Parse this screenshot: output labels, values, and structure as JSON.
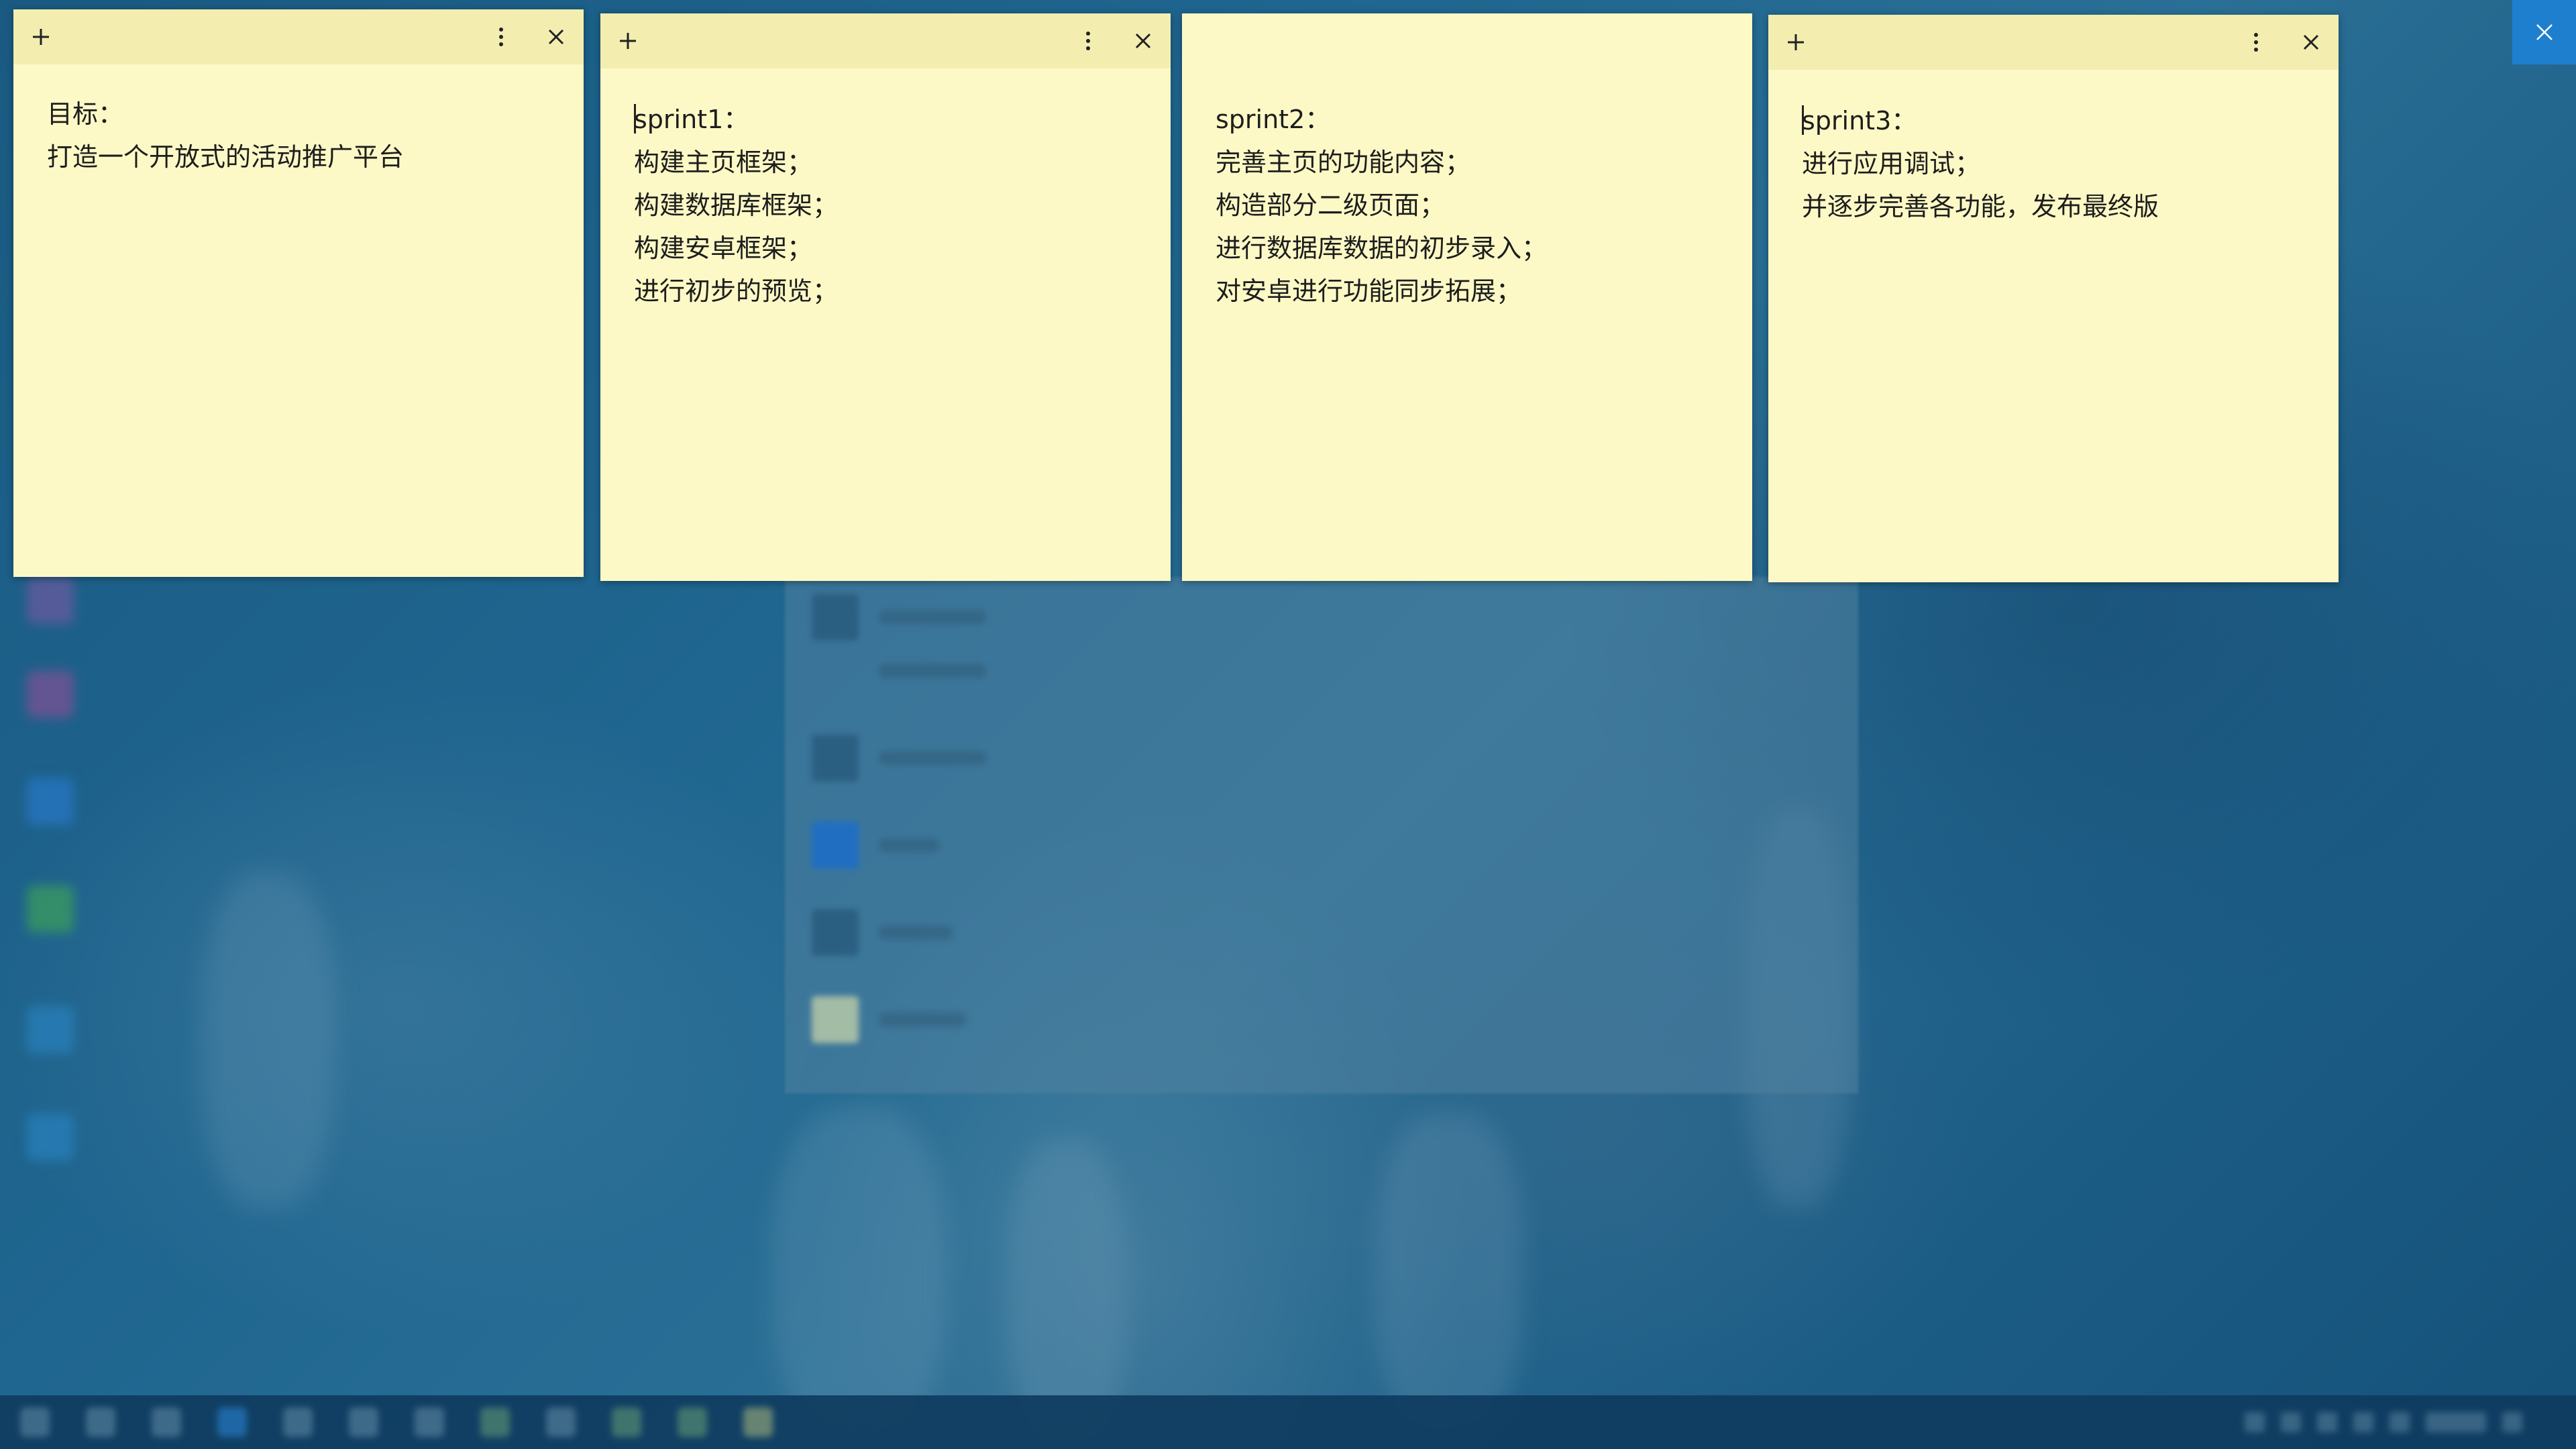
{
  "screen": {
    "colors": {
      "note_body": "#fdf9c6",
      "note_header": "#f3eeb0",
      "corner_close": "#1f7fcf",
      "desktop": "#1f6690"
    }
  },
  "corner_close": {
    "icon": "close-icon"
  },
  "notes": [
    {
      "has_header": true,
      "header_icons": [
        "add-icon",
        "more-vertical-icon",
        "close-icon"
      ],
      "lines": [
        "目标：",
        "打造一个开放式的活动推广平台"
      ],
      "has_caret": false
    },
    {
      "has_header": true,
      "header_icons": [
        "add-icon",
        "more-vertical-icon",
        "close-icon"
      ],
      "lines": [
        "sprint1：",
        "构建主页框架；",
        "构建数据库框架；",
        "构建安卓框架；",
        "进行初步的预览；"
      ],
      "has_caret": true
    },
    {
      "has_header": false,
      "lines": [
        "sprint2：",
        "完善主页的功能内容；",
        "构造部分二级页面；",
        "进行数据库数据的初步录入；",
        "对安卓进行功能同步拓展；"
      ],
      "has_caret": false
    },
    {
      "has_header": true,
      "header_icons": [
        "add-icon",
        "more-vertical-icon",
        "close-icon"
      ],
      "lines": [
        "sprint3：",
        "进行应用调试；",
        "并逐步完善各功能，发布最终版"
      ],
      "has_caret": true
    }
  ]
}
